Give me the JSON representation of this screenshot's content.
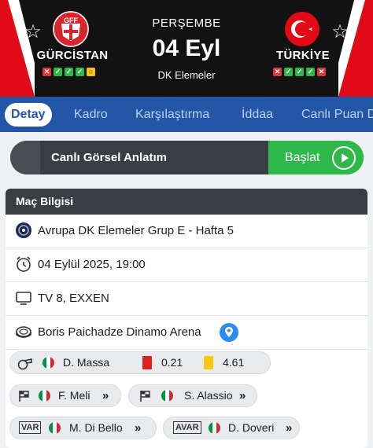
{
  "header": {
    "day": "PERŞEMBE",
    "date": "04 Eyl",
    "competition": "DK Elemeler",
    "home": {
      "name": "GÜRCİSTAN",
      "logo_text": "GFF",
      "form": [
        {
          "mark": "✕",
          "result": "l"
        },
        {
          "mark": "✓",
          "result": "w"
        },
        {
          "mark": "✓",
          "result": "w"
        },
        {
          "mark": "✓",
          "result": "w"
        },
        {
          "mark": "○",
          "result": "d"
        }
      ]
    },
    "away": {
      "name": "TÜRKİYE",
      "form": [
        {
          "mark": "✕",
          "result": "l"
        },
        {
          "mark": "✓",
          "result": "w"
        },
        {
          "mark": "✓",
          "result": "w"
        },
        {
          "mark": "✓",
          "result": "w"
        },
        {
          "mark": "✕",
          "result": "l"
        }
      ]
    }
  },
  "tabs": {
    "detail": "Detay",
    "squad": "Kadro",
    "comparison": "Karşılaştırma",
    "bet": "İddaa",
    "live_points": "Canlı Puan D"
  },
  "live": {
    "label": "Canlı Görsel Anlatım",
    "button": "Başlat"
  },
  "match_info": {
    "title": "Maç Bilgisi",
    "league": "Avrupa DK Elemeler Grup E - Hafta 5",
    "datetime": "04 Eylül 2025, 19:00",
    "broadcast": "TV 8, EXXEN",
    "stadium": "Boris Paichadze Dinamo Arena",
    "referee": {
      "name": "D. Massa",
      "red_avg": "0.21",
      "yellow_avg": "4.61"
    },
    "assistant_1": "F. Meli",
    "assistant_2": "S. Alassio",
    "var_label": "VAR",
    "var_ref": "M. Di Bello",
    "avar_label": "AVAR",
    "avar_ref": "D. Doveri"
  },
  "colors": {
    "tab_bar": "#2456a8",
    "live_green": "#2fb84a",
    "header_bg": "#121212"
  }
}
